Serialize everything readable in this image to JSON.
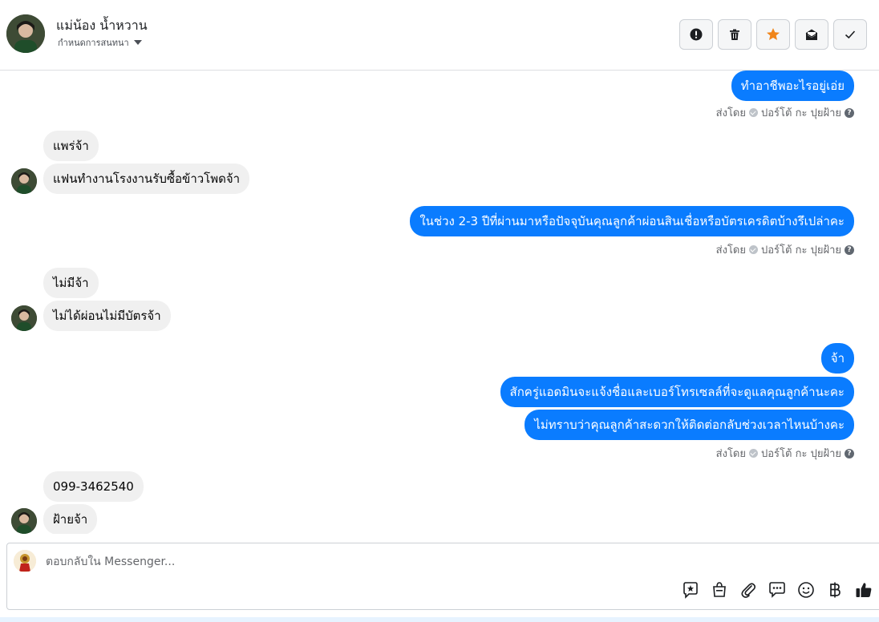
{
  "header": {
    "contact_name": "แม่น้อง น้ำหวาน",
    "assign_label": "กำหนดการสนทนา",
    "actions": [
      {
        "icon": "alert-icon",
        "name": "report-button"
      },
      {
        "icon": "trash-icon",
        "name": "delete-button"
      },
      {
        "icon": "star-icon",
        "name": "star-button"
      },
      {
        "icon": "mark-unread-icon",
        "name": "mark-unread-button"
      },
      {
        "icon": "check-icon",
        "name": "mark-done-button"
      }
    ],
    "star_color": "#f0851a"
  },
  "thread": {
    "outgoing_color": "#0a7cff",
    "incoming_color": "#f0f0f0",
    "sent_by_prefix": "ส่งโดย",
    "sent_by_name": "ปอร์โต้ กะ ปุยฝ้าย",
    "messages": [
      {
        "dir": "out",
        "text": "ทำอาชีพอะไรอยู่เอ่ย"
      },
      {
        "dir": "in",
        "text": "แพร่จ้า"
      },
      {
        "dir": "in",
        "text": "แฟนทำงานโรงงานรับซื้อข้าวโพดจ้า"
      },
      {
        "dir": "out",
        "text": "ในช่วง 2-3 ปีที่ผ่านมาหรือปัจจุบันคุณลูกค้าผ่อนสินเชื่อหรือบัตรเครดิตบ้างรึเปล่าคะ"
      },
      {
        "dir": "in",
        "text": "ไม่มีจ้า"
      },
      {
        "dir": "in",
        "text": "ไม่ได้ผ่อนไม่มีบัตรจ้า"
      },
      {
        "dir": "out",
        "text": "จ้า"
      },
      {
        "dir": "out",
        "text": "สักครู่แอดมินจะแจ้งชื่อและเบอร์โทรเซลล์ที่จะดูแลคุณลูกค้านะคะ"
      },
      {
        "dir": "out",
        "text": "ไม่ทราบว่าคุณลูกค้าสะดวกให้ติดต่อกลับช่วงเวลาไหนบ้างคะ"
      },
      {
        "dir": "in",
        "text": "099-3462540"
      },
      {
        "dir": "in",
        "text": "ฝ้ายจ้า"
      }
    ]
  },
  "composer": {
    "placeholder": "ตอบกลับใน Messenger...",
    "tools": [
      "saved-reply-icon",
      "shop-bag-icon",
      "attachment-icon",
      "chat-bubbles-icon",
      "emoji-icon",
      "baht-icon",
      "like-icon"
    ]
  }
}
